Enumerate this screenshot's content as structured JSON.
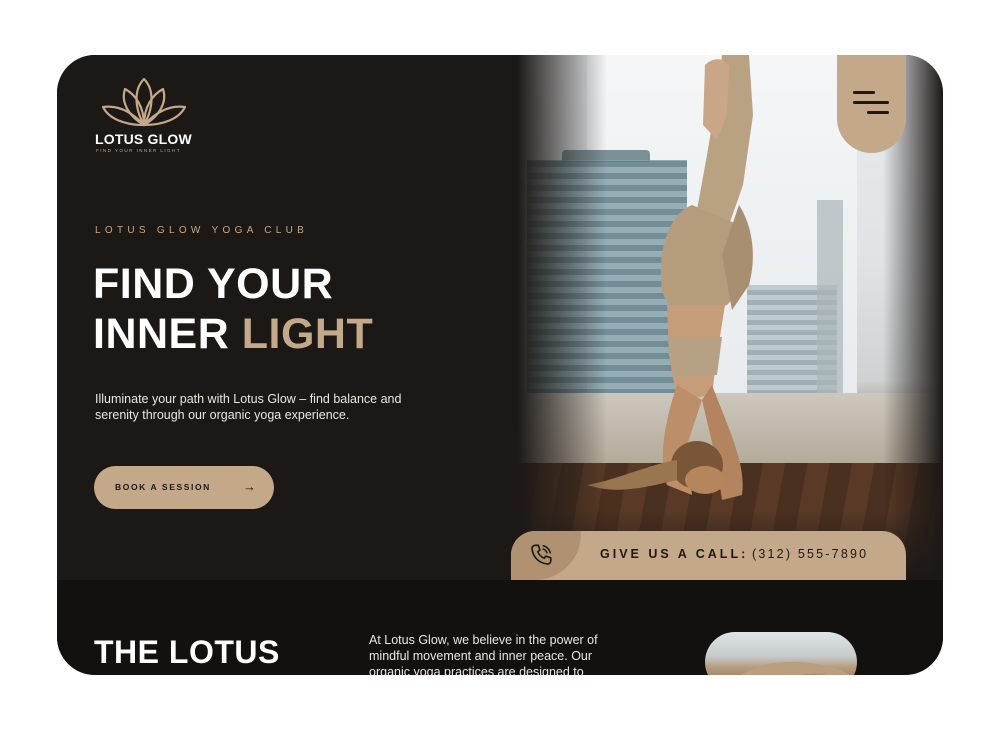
{
  "brand": {
    "name": "LOTUS GLOW",
    "tagline": "FIND YOUR INNER LIGHT"
  },
  "hero": {
    "eyebrow": "LOTUS GLOW YOGA CLUB",
    "headline_line1": "FIND YOUR",
    "headline_line2_a": "INNER",
    "headline_line2_b": "LIGHT",
    "description": "Illuminate your path with Lotus Glow – find balance and serenity through our organic yoga experience.",
    "cta_label": "BOOK A SESSION",
    "cta_icon": "arrow-right-icon"
  },
  "menu": {
    "icon": "hamburger-menu-icon"
  },
  "call": {
    "label": "GIVE US A CALL:",
    "number": "(312) 555-7890",
    "icon": "phone-icon"
  },
  "about": {
    "title": "THE LOTUS",
    "text": "At Lotus Glow, we believe in the power of mindful movement and inner peace. Our organic yoga practices are designed to"
  },
  "colors": {
    "background": "#1c1816",
    "accent": "#c4a88a",
    "section_dark": "#121110",
    "text": "#ffffff"
  }
}
